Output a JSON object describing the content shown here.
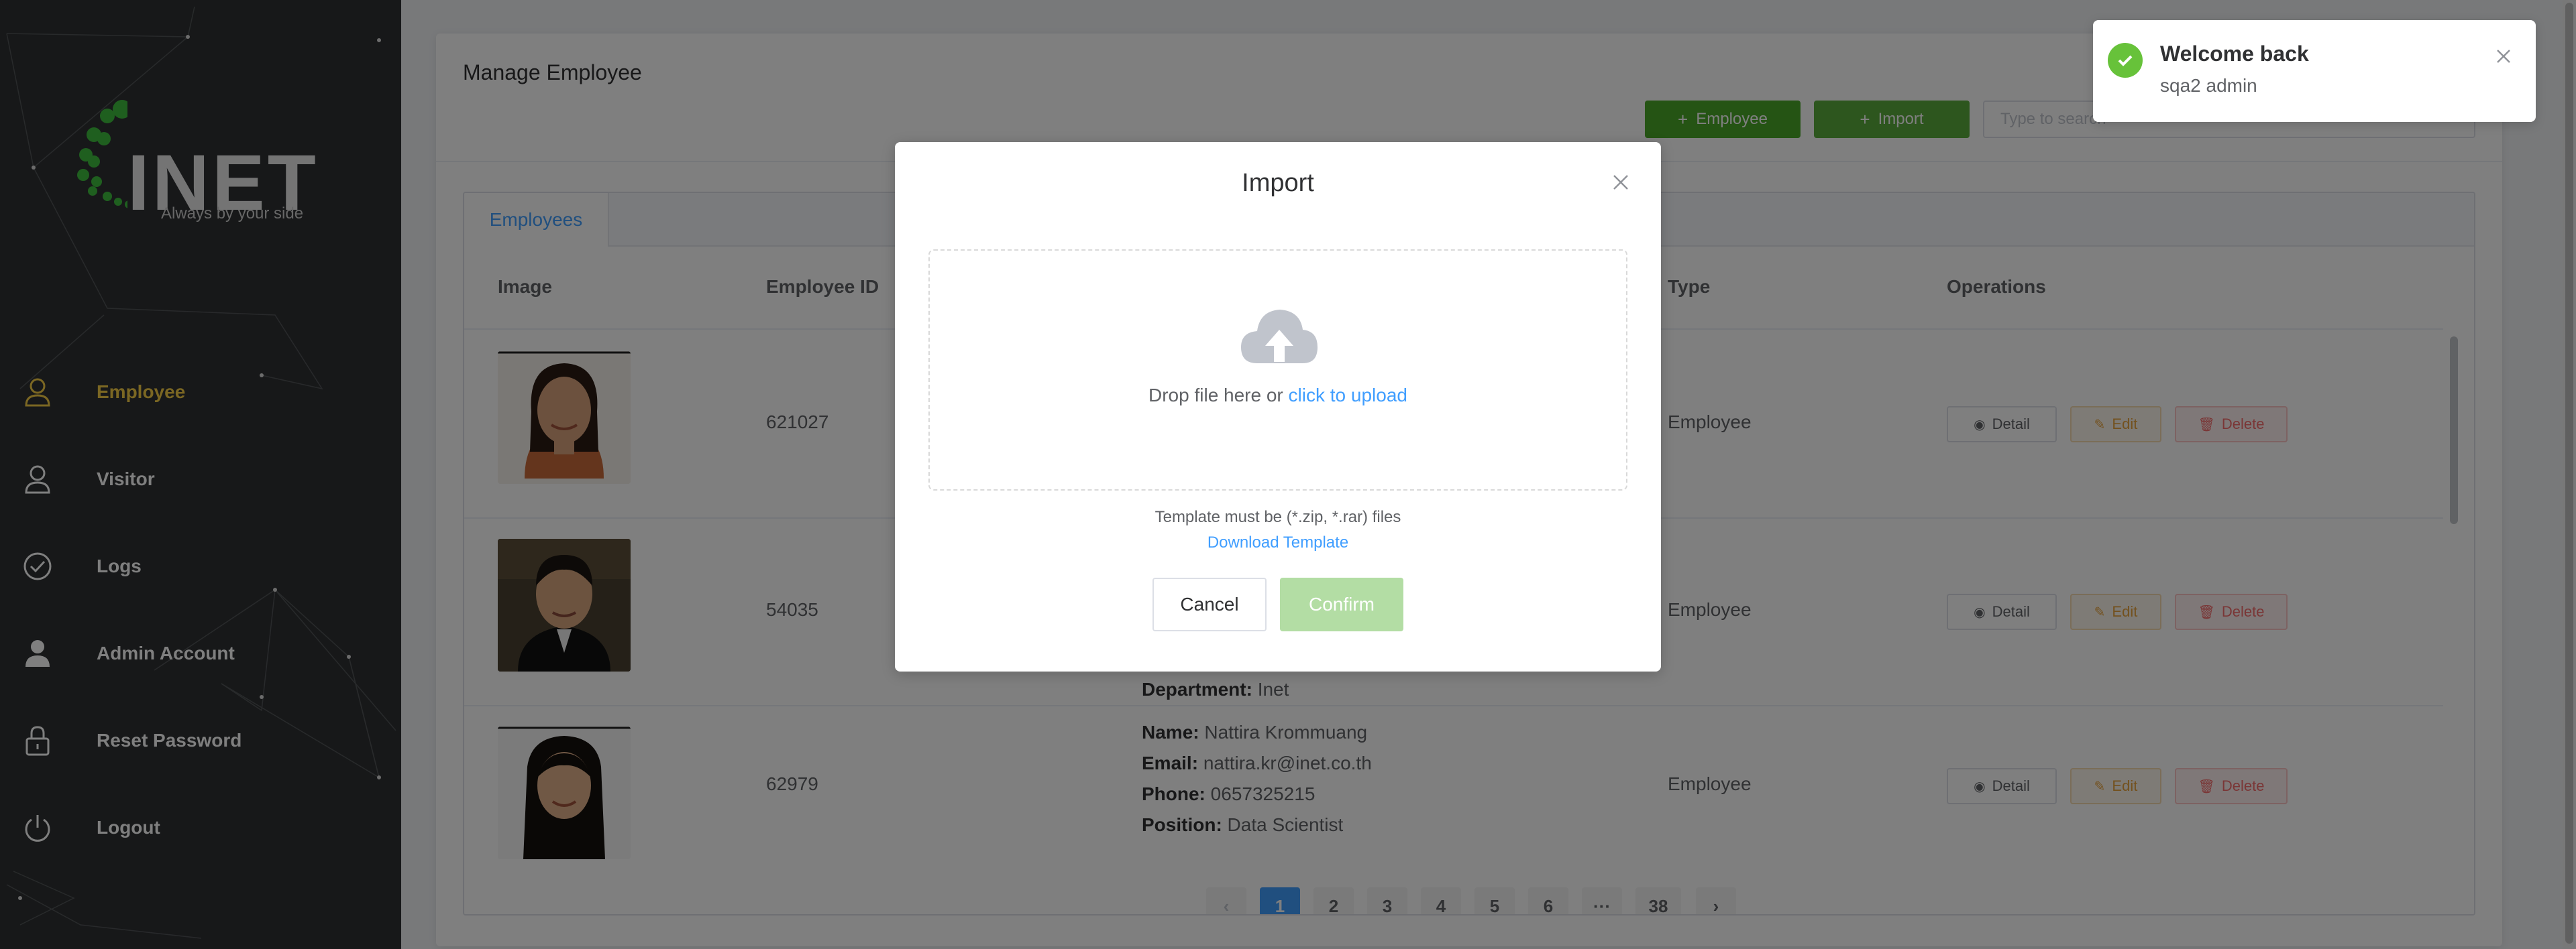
{
  "sidebar": {
    "logo_text": "INET",
    "logo_tagline": "Always by your side",
    "items": [
      {
        "label": "Employee",
        "icon": "user-icon",
        "active": true
      },
      {
        "label": "Visitor",
        "icon": "user-outline-icon",
        "active": false
      },
      {
        "label": "Logs",
        "icon": "check-circle-icon",
        "active": false
      },
      {
        "label": "Admin Account",
        "icon": "admin-user-icon",
        "active": false
      },
      {
        "label": "Reset Password",
        "icon": "lock-icon",
        "active": false
      },
      {
        "label": "Logout",
        "icon": "power-icon",
        "active": false
      }
    ]
  },
  "page": {
    "title": "Manage Employee",
    "add_employee_label": "Employee",
    "import_label": "Import",
    "search_placeholder": "Type to search"
  },
  "table": {
    "tab_label": "Employees",
    "headers": {
      "image": "Image",
      "employee_id": "Employee ID",
      "type": "Type",
      "operations": "Operations"
    },
    "rows": [
      {
        "employee_id": "621027",
        "type": "Employee",
        "info": []
      },
      {
        "employee_id": "54035",
        "type": "Employee",
        "info": [
          {
            "key": "Department:",
            "value": "Inet"
          }
        ]
      },
      {
        "employee_id": "62979",
        "type": "Employee",
        "info": [
          {
            "key": "Name:",
            "value": "Nattira Krommuang"
          },
          {
            "key": "Email:",
            "value": "nattira.kr@inet.co.th"
          },
          {
            "key": "Phone:",
            "value": "0657325215"
          },
          {
            "key": "Position:",
            "value": "Data Scientist"
          }
        ]
      }
    ],
    "operations": {
      "detail": "Detail",
      "edit": "Edit",
      "delete": "Delete"
    }
  },
  "pagination": {
    "pages": [
      "1",
      "2",
      "3",
      "4",
      "5",
      "6",
      "···",
      "38"
    ],
    "current": "1"
  },
  "dialog": {
    "title": "Import",
    "drop_text": "Drop file here or ",
    "drop_link": "click to upload",
    "tip": "Template must be (*.zip, *.rar) files",
    "download_link": "Download Template",
    "cancel_label": "Cancel",
    "confirm_label": "Confirm"
  },
  "toast": {
    "title": "Welcome back",
    "message": "sqa2 admin"
  },
  "colors": {
    "sidebar_bg": "#2f3133",
    "active_nav": "#f7ce46",
    "primary_green": "#4aa829",
    "primary_blue": "#409eff",
    "success": "#67c23a",
    "danger": "#f56c6c",
    "warning": "#e6a23c"
  }
}
